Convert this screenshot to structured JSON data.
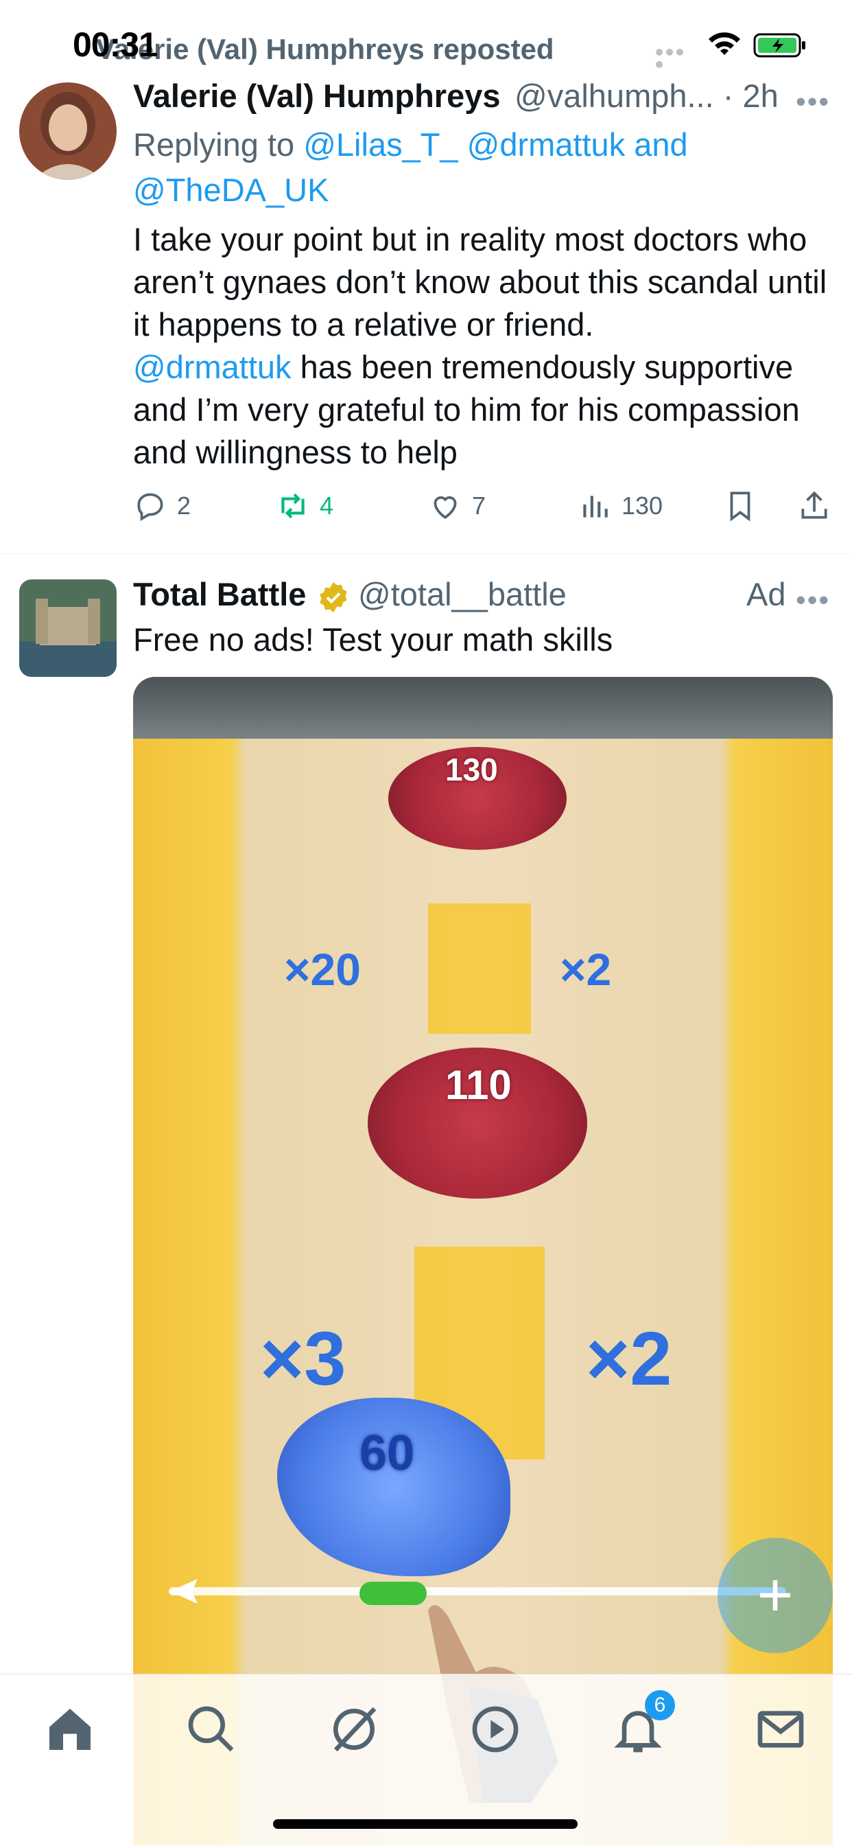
{
  "status_bar": {
    "time": "00:31"
  },
  "repost": {
    "text": "Valerie (Val) Humphreys reposted"
  },
  "tweet1": {
    "author_name": "Valerie (Val) Humphreys",
    "author_handle_time": "@valhumph... · 2h",
    "replying_prefix": "Replying to ",
    "reply_handle_1": "@Lilas_T_",
    "reply_handle_2": "@drmattuk",
    "reply_and": " and",
    "reply_handle_3": "@TheDA_UK",
    "body_part1": "I take your point but in reality most doctors who aren’t gynaes don’t know about this scandal until it happens to a relative or friend. ",
    "body_mention": "@drmattuk",
    "body_part2": " has been tremendously supportive and I’m very grateful to him for his compassion and willingness to help",
    "replies": "2",
    "reposts": "4",
    "likes": "7",
    "views": "130"
  },
  "tweet2": {
    "author_name": "Total Battle",
    "author_handle": "@total__battle",
    "ad_label": "Ad",
    "text": "Free no ads! Test your math skills",
    "media": {
      "counts": [
        "130",
        "110",
        "60"
      ],
      "multipliers": [
        "×20",
        "×2",
        "×3",
        "×2"
      ]
    }
  },
  "fab": {
    "icon": "plus-icon",
    "label": "+"
  },
  "tabbar": {
    "icons": [
      "home-icon",
      "search-icon",
      "grok-icon",
      "play-icon",
      "bell-icon",
      "mail-icon"
    ],
    "notification_badge": "6"
  },
  "colors": {
    "link": "#1d9bf0",
    "repost_active": "#00ba7c",
    "secondary_text": "#536471"
  }
}
